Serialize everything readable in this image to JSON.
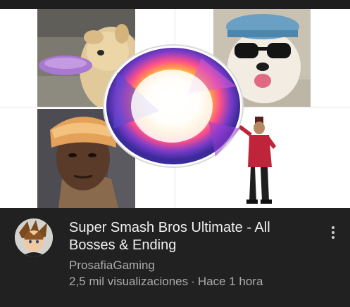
{
  "video": {
    "title": "Super Smash Bros Ultimate - All Bosses & Ending",
    "channel": "ProsafiaGaming",
    "views": "2,5 mil visualizaciones",
    "separator": "·",
    "published": "Hace 1 hora"
  },
  "thumbnail": {
    "tiles": [
      "dog-frisbee",
      "dog-glasses",
      "man-hat",
      "dancer"
    ],
    "center": "smash-orb"
  },
  "icons": {
    "more": "vertical-dots-icon",
    "avatar": "channel-avatar"
  },
  "colors": {
    "background": "#212121",
    "title": "#f1f1f1",
    "secondary": "#aaaaaa"
  }
}
